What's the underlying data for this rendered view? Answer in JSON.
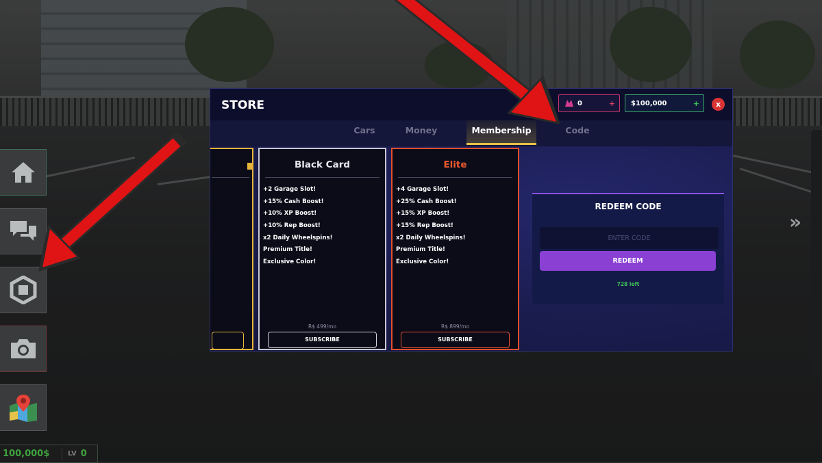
{
  "hud": {
    "buttons": [
      {
        "icon": "home-icon"
      },
      {
        "icon": "chat-icon"
      },
      {
        "icon": "store-hexagon-icon"
      },
      {
        "icon": "camera-icon"
      },
      {
        "icon": "map-icon"
      }
    ],
    "money": "100,000$",
    "level_label": "LV",
    "level_value": "0"
  },
  "store": {
    "title": "STORE",
    "robux_amount": "0",
    "robux_plus": "+",
    "cash_amount": "$100,000",
    "cash_plus": "+",
    "close_label": "x",
    "tabs": [
      {
        "label": "Cars"
      },
      {
        "label": "Money"
      },
      {
        "label": "Membership",
        "active": true
      },
      {
        "label": "Code"
      }
    ],
    "cards": [
      {
        "title": "Black Card",
        "perks": [
          "+2 Garage Slot!",
          "+15% Cash Boost!",
          "+10% XP Boost!",
          "+10% Rep Boost!",
          "x2 Daily Wheelspins!",
          "Premium Title!",
          "Exclusive Color!"
        ],
        "price": "R$ 499/mo",
        "button": "SUBSCRIBE"
      },
      {
        "title": "Elite",
        "perks": [
          "+4 Garage Slot!",
          "+25% Cash Boost!",
          "+15% XP Boost!",
          "+15% Rep Boost!",
          "x2 Daily Wheelspins!",
          "Premium Title!",
          "Exclusive Color!"
        ],
        "price": "R$ 899/mo",
        "button": "SUBSCRIBE"
      }
    ],
    "redeem": {
      "title": "REDEEM CODE",
      "placeholder": "ENTER CODE",
      "button": "REDEEM",
      "remaining": "728 left"
    }
  },
  "colors": {
    "gold_card": "#e7b53a",
    "black_card": "#c9c9d4",
    "elite_card": "#e6502e",
    "elite_title": "#ef5a2f",
    "redeem_button": "#8a41d3",
    "arrow": "#e01414"
  }
}
